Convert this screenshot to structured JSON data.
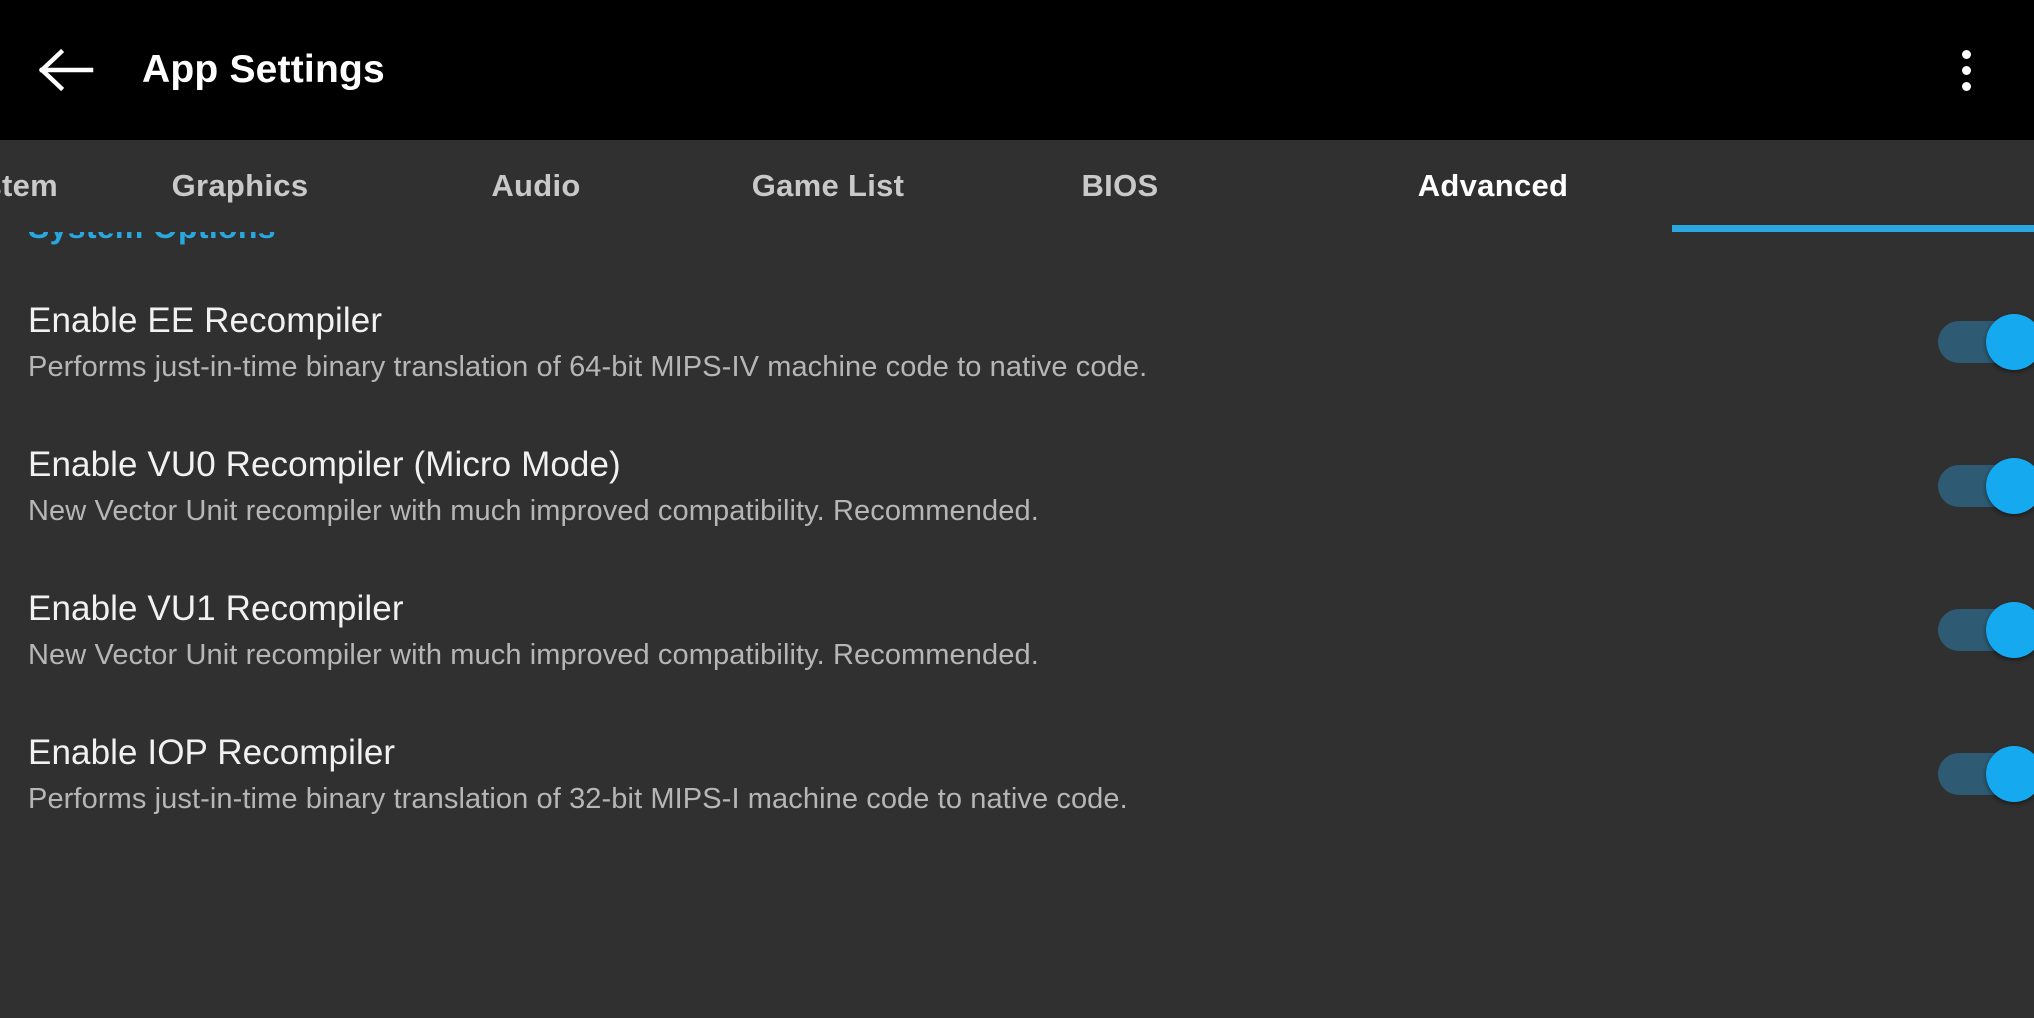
{
  "appbar": {
    "back_icon": "arrow-left-icon",
    "title": "App Settings",
    "overflow_icon": "more-vertical-icon"
  },
  "tabs": {
    "items": [
      {
        "label": "System",
        "active": false,
        "clipped": true
      },
      {
        "label": "Graphics",
        "active": false
      },
      {
        "label": "Audio",
        "active": false
      },
      {
        "label": "Game List",
        "active": false
      },
      {
        "label": "BIOS",
        "active": false
      },
      {
        "label": "Advanced",
        "active": true
      }
    ],
    "active_index": 5,
    "indicator_color": "#29a8e0"
  },
  "content": {
    "section_header": "System Options",
    "section_header_color": "#29a8e0",
    "settings": [
      {
        "title": "Enable EE Recompiler",
        "description": "Performs just-in-time binary translation of 64-bit MIPS-IV machine code to native code.",
        "toggle": "on"
      },
      {
        "title": "Enable VU0 Recompiler (Micro Mode)",
        "description": "New Vector Unit recompiler with much improved compatibility. Recommended.",
        "toggle": "on"
      },
      {
        "title": "Enable VU1 Recompiler",
        "description": "New Vector Unit recompiler with much improved compatibility. Recommended.",
        "toggle": "on"
      },
      {
        "title": "Enable IOP Recompiler",
        "description": "Performs just-in-time binary translation of 32-bit MIPS-I machine code to native code.",
        "toggle": "on"
      }
    ]
  },
  "theme": {
    "appbar_background": "#000000",
    "page_background": "#303030",
    "accent": "#15a9f0",
    "title_text": "#f1f1f1",
    "description_text": "#b6b6b6",
    "tab_inactive_text": "#c9c9c9",
    "tab_active_text": "#ffffff",
    "switch_track_on": "#2e5a73"
  }
}
